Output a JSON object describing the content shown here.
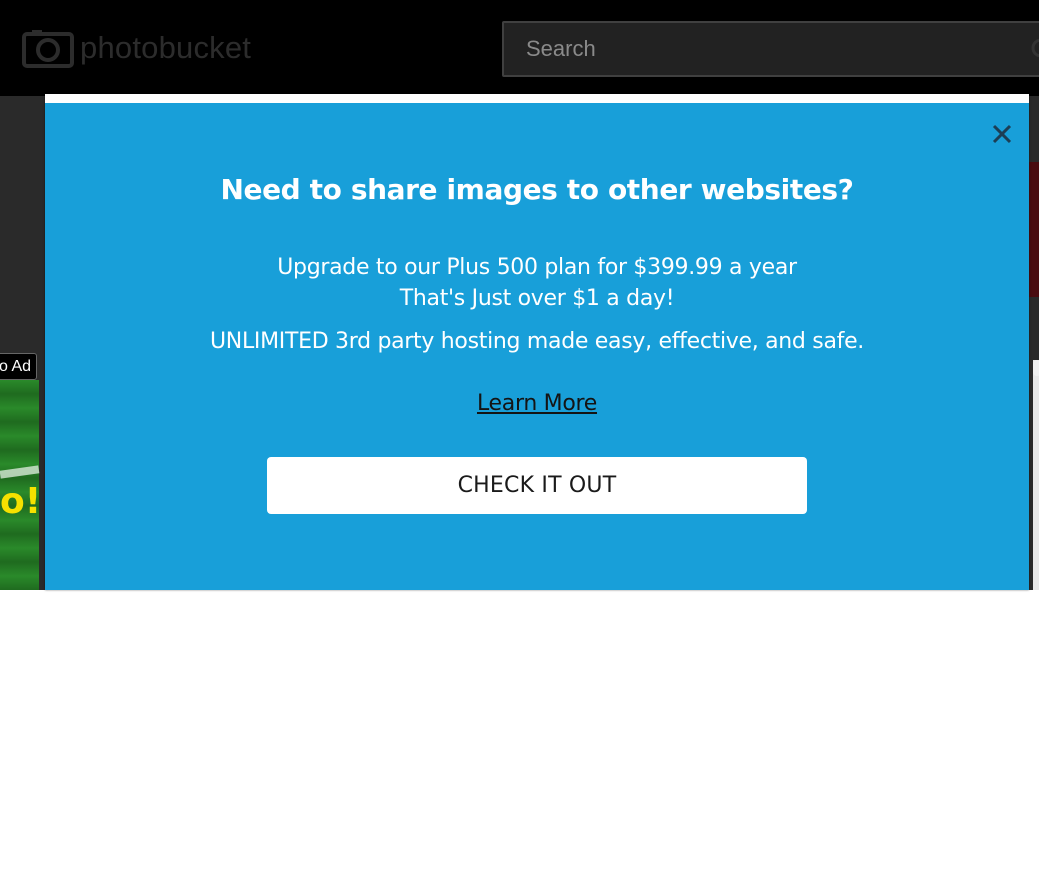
{
  "header": {
    "logo_text": "photobucket",
    "search_placeholder": "Search"
  },
  "ad": {
    "badge": "o Ad",
    "banner_text": "o!!"
  },
  "modal": {
    "title": "Need to share images to other websites?",
    "line1": "Upgrade to our Plus 500 plan for $399.99 a year",
    "line2": "That's Just over $1 a day!",
    "line3": "UNLIMITED 3rd party hosting made easy, effective, and safe.",
    "learn_more": "Learn More",
    "cta_label": "CHECK IT OUT",
    "accent_color": "#189fd9"
  },
  "icons": {
    "close": "close-icon",
    "search": "search-icon",
    "logo": "camera-icon"
  }
}
